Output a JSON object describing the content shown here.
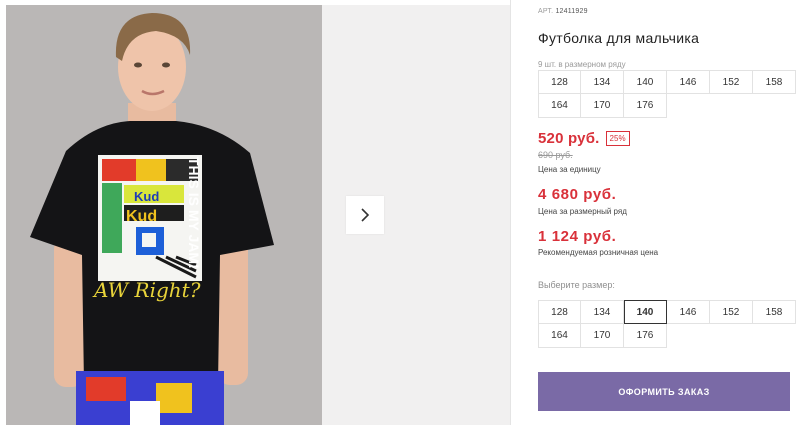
{
  "gallery": {
    "shirt_lines": [
      "THIS IS MY JAM!",
      "Kud",
      "Kud",
      "AW Right?"
    ]
  },
  "product": {
    "art_label": "АРТ.",
    "art_number": "12411929",
    "title": "Футболка для мальчика",
    "size_count": "9 шт. в размерном ряду",
    "sizes_row": [
      "128",
      "134",
      "140",
      "146",
      "152",
      "158",
      "164",
      "170",
      "176"
    ]
  },
  "pricing": {
    "price": "520 руб.",
    "discount": "25%",
    "old_price": "690 руб.",
    "unit_note": "Цена за единицу",
    "row_price": "4 680 руб.",
    "row_note": "Цена за размерный ряд",
    "retail_price": "1 124 руб.",
    "retail_note": "Рекомендуемая розничная цена"
  },
  "size_select": {
    "label": "Выберите размер:",
    "options": [
      "128",
      "134",
      "140",
      "146",
      "152",
      "158",
      "164",
      "170",
      "176"
    ],
    "selected": "140"
  },
  "order": {
    "button_label": "ОФОРМИТЬ ЗАКАЗ"
  },
  "colors": {
    "accent": "#7a6aa6",
    "price_red": "#d9313a"
  }
}
